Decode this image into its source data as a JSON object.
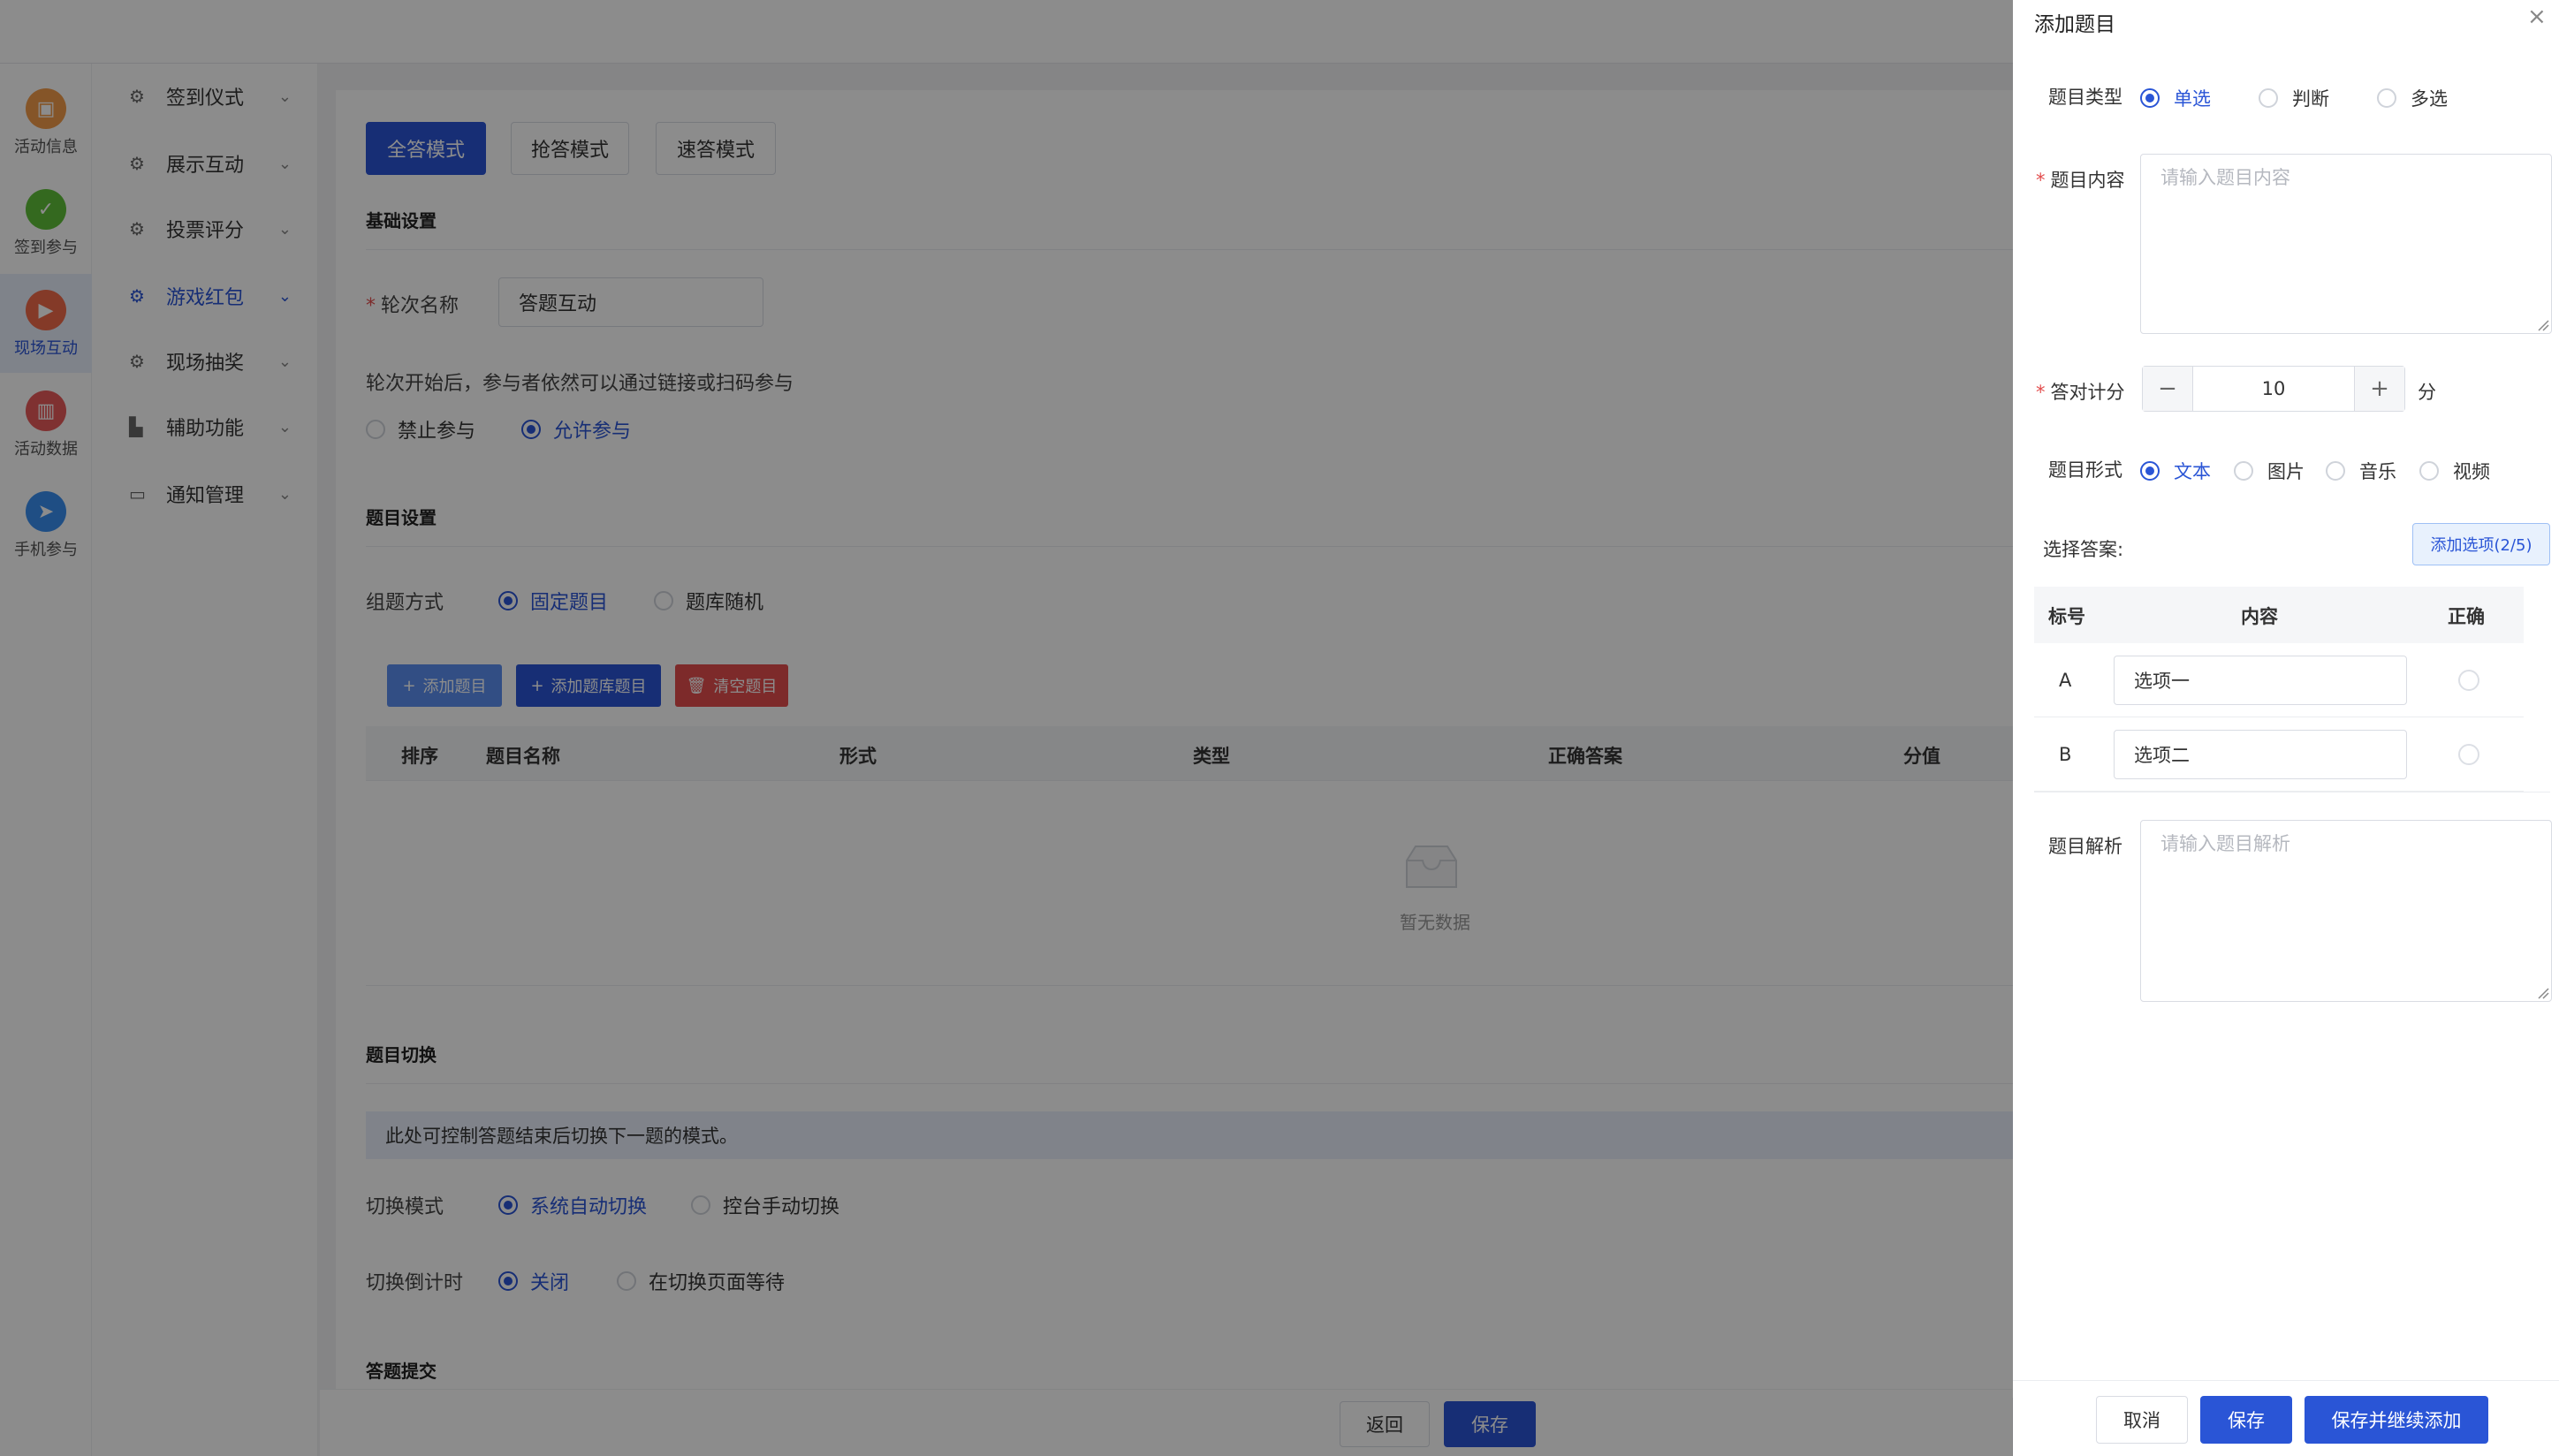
{
  "sidebar": {
    "items": [
      {
        "label": "活动信息",
        "icon": "activity-info-icon",
        "color": "#f39c4a"
      },
      {
        "label": "签到参与",
        "icon": "checkin-icon",
        "color": "#5fbf3a"
      },
      {
        "label": "现场互动",
        "icon": "live-interaction-icon",
        "color": "#f06b4a"
      },
      {
        "label": "活动数据",
        "icon": "data-chart-icon",
        "color": "#e85a5a"
      },
      {
        "label": "手机参与",
        "icon": "mobile-send-icon",
        "color": "#3a8ff0"
      }
    ]
  },
  "submenu": {
    "items": [
      {
        "label": "签到仪式",
        "icon": "gear-icon"
      },
      {
        "label": "展示互动",
        "icon": "gear-icon"
      },
      {
        "label": "投票评分",
        "icon": "gear-icon"
      },
      {
        "label": "游戏红包",
        "icon": "gear-icon"
      },
      {
        "label": "现场抽奖",
        "icon": "gear-icon"
      },
      {
        "label": "辅助功能",
        "icon": "building-icon"
      },
      {
        "label": "通知管理",
        "icon": "notification-icon"
      }
    ]
  },
  "modes": [
    "全答模式",
    "抢答模式",
    "速答模式"
  ],
  "basic": {
    "section": "基础设置",
    "round_label": "轮次名称",
    "round_value": "答题互动",
    "join_hint": "轮次开始后，参与者依然可以通过链接或扫码参与",
    "join_options": [
      "禁止参与",
      "允许参与"
    ]
  },
  "question_settings": {
    "section": "题目设置",
    "group_label": "组题方式",
    "group_options": [
      "固定题目",
      "题库随机"
    ],
    "buttons": {
      "add": "添加题目",
      "add_bank": "添加题库题目",
      "clear": "清空题目"
    },
    "columns": [
      "排序",
      "题目名称",
      "形式",
      "类型",
      "正确答案",
      "分值"
    ],
    "empty": "暂无数据"
  },
  "switch": {
    "section": "题目切换",
    "info": "此处可控制答题结束后切换下一题的模式。",
    "mode_label": "切换模式",
    "mode_options": [
      "系统自动切换",
      "控台手动切换"
    ],
    "countdown_label": "切换倒计时",
    "countdown_options": [
      "关闭",
      "在切换页面等待"
    ]
  },
  "submit": {
    "section": "答题提交"
  },
  "bottom": {
    "back": "返回",
    "save": "保存"
  },
  "drawer": {
    "title": "添加题目",
    "type_label": "题目类型",
    "type_options": [
      "单选",
      "判断",
      "多选"
    ],
    "content_label": "题目内容",
    "content_placeholder": "请输入题目内容",
    "score_label": "答对计分",
    "score_value": "10",
    "score_unit": "分",
    "form_label": "题目形式",
    "form_options": [
      "文本",
      "图片",
      "音乐",
      "视频"
    ],
    "answer_label": "选择答案:",
    "add_option": "添加选项(2/5)",
    "option_cols": [
      "标号",
      "内容",
      "正确"
    ],
    "options": [
      {
        "letter": "A",
        "value": "选项一"
      },
      {
        "letter": "B",
        "value": "选项二"
      }
    ],
    "analysis_label": "题目解析",
    "analysis_placeholder": "请输入题目解析",
    "buttons": {
      "cancel": "取消",
      "save": "保存",
      "save_continue": "保存并继续添加"
    }
  },
  "colors": {
    "primary": "#2a55d6",
    "danger": "#e34d4d",
    "light_blue": "#5b8ff0"
  }
}
